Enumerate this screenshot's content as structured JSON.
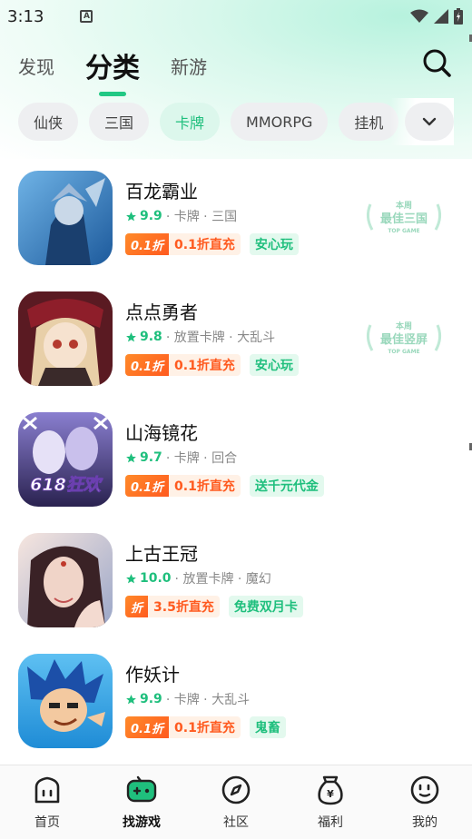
{
  "status_bar": {
    "time": "3:13",
    "notification_icon": "a-box-icon"
  },
  "tabs": [
    {
      "label": "发现",
      "active": false
    },
    {
      "label": "分类",
      "active": true
    },
    {
      "label": "新游",
      "active": false
    }
  ],
  "categories": [
    {
      "label": "仙侠",
      "active": false
    },
    {
      "label": "三国",
      "active": false
    },
    {
      "label": "卡牌",
      "active": true
    },
    {
      "label": "MMORPG",
      "active": false
    },
    {
      "label": "挂机",
      "active": false
    }
  ],
  "games": [
    {
      "name": "百龙霸业",
      "rating": "9.9",
      "genres": "· 卡牌 · 三国",
      "promo_badge": "0.1折",
      "promo_text": "0.1折直充",
      "feature": "安心玩",
      "award": {
        "line1": "本周",
        "line2": "最佳三国",
        "line3": "TOP GAME"
      },
      "icon_colors": [
        "#1d5a9c",
        "#6fb3e6",
        "#c9d8e8"
      ]
    },
    {
      "name": "点点勇者",
      "rating": "9.8",
      "genres": "· 放置卡牌 · 大乱斗",
      "promo_badge": "0.1折",
      "promo_text": "0.1折直充",
      "feature": "安心玩",
      "award": {
        "line1": "本周",
        "line2": "最佳竖屏",
        "line3": "TOP GAME"
      },
      "icon_colors": [
        "#5a1a22",
        "#e8cfa8",
        "#3a2a2a"
      ]
    },
    {
      "name": "山海镜花",
      "rating": "9.7",
      "genres": "· 卡牌 · 回合",
      "promo_badge": "0.1折",
      "promo_text": "0.1折直充",
      "feature": "送千元代金",
      "icon_text": "618狂欢",
      "icon_colors": [
        "#2a2250",
        "#8a7fd0",
        "#e6e1f7"
      ]
    },
    {
      "name": "上古王冠",
      "rating": "10.0",
      "genres": "· 放置卡牌 · 魔幻",
      "promo_badge": "折",
      "promo_text": "3.5折直充",
      "feature": "免费双月卡",
      "icon_colors": [
        "#f0d4c8",
        "#3a2226",
        "#9aa6c8"
      ]
    },
    {
      "name": "作妖计",
      "rating": "9.9",
      "genres": "· 卡牌 · 大乱斗",
      "promo_badge": "0.1折",
      "promo_text": "0.1折直充",
      "feature": "鬼畜",
      "icon_colors": [
        "#1f8cd6",
        "#5ec0f2",
        "#f3c9a0"
      ]
    }
  ],
  "bottom_nav": [
    {
      "label": "首页",
      "icon": "home-icon",
      "active": false
    },
    {
      "label": "找游戏",
      "icon": "gamepad-icon",
      "active": true
    },
    {
      "label": "社区",
      "icon": "compass-icon",
      "active": false
    },
    {
      "label": "福利",
      "icon": "money-bag-icon",
      "active": false
    },
    {
      "label": "我的",
      "icon": "profile-face-icon",
      "active": false
    }
  ],
  "colors": {
    "accent": "#1fbf7d",
    "promo": "#ff5a1f"
  }
}
